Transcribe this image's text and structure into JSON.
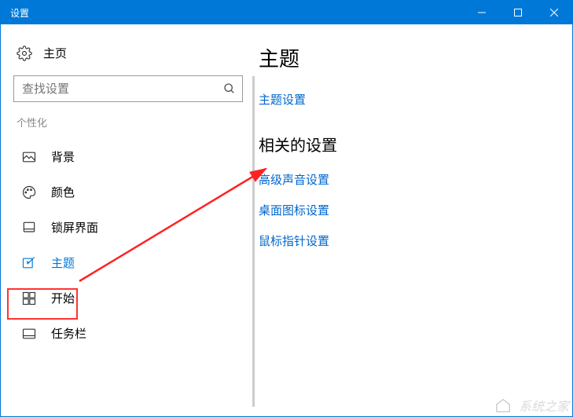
{
  "titlebar": {
    "title": "设置"
  },
  "sidebar": {
    "home": "主页",
    "search_placeholder": "查找设置",
    "section": "个性化",
    "items": [
      {
        "label": "背景"
      },
      {
        "label": "颜色"
      },
      {
        "label": "锁屏界面"
      },
      {
        "label": "主题"
      },
      {
        "label": "开始"
      },
      {
        "label": "任务栏"
      }
    ]
  },
  "main": {
    "heading": "主题",
    "theme_link": "主题设置",
    "related_heading": "相关的设置",
    "related_links": [
      "高级声音设置",
      "桌面图标设置",
      "鼠标指针设置"
    ]
  },
  "watermark": "系统之家"
}
